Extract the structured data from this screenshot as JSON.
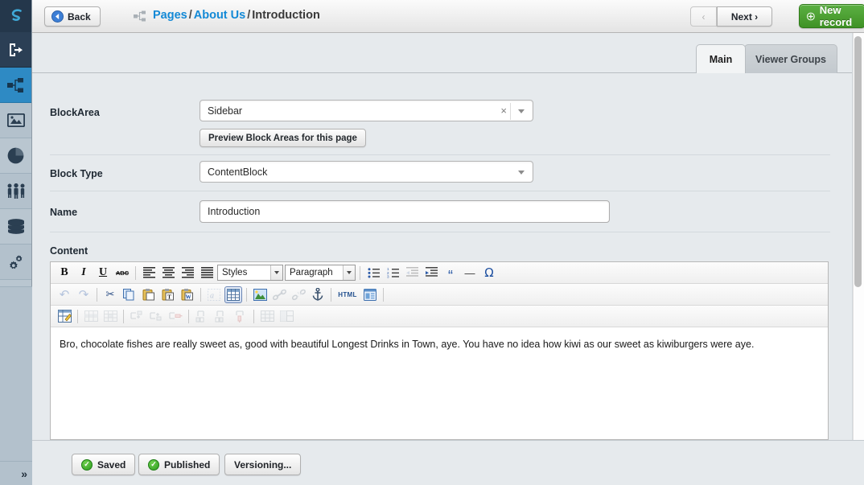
{
  "window": {
    "title": "Introduction"
  },
  "sidebar": {
    "expand_label": "»",
    "items": [
      {
        "name": "logo",
        "icon": "silverstripe-logo-icon",
        "label": ""
      },
      {
        "name": "logout",
        "icon": "logout-icon",
        "label": ""
      },
      {
        "name": "pages",
        "icon": "sitetree-icon",
        "label": "",
        "active": true
      },
      {
        "name": "files",
        "icon": "image-icon",
        "label": ""
      },
      {
        "name": "reports",
        "icon": "pie-chart-icon",
        "label": ""
      },
      {
        "name": "security",
        "icon": "users-icon",
        "label": ""
      },
      {
        "name": "models",
        "icon": "database-icon",
        "label": ""
      },
      {
        "name": "settings",
        "icon": "gears-icon",
        "label": ""
      },
      {
        "name": "help",
        "icon": "info-icon",
        "label": ""
      }
    ]
  },
  "header": {
    "back_label": "Back",
    "breadcrumb": {
      "tree_icon": "sitetree-icon",
      "parts": [
        {
          "text": "Pages",
          "link": true
        },
        {
          "text": "/",
          "link": false
        },
        {
          "text": "About Us",
          "link": true
        },
        {
          "text": "/",
          "link": false
        },
        {
          "text": "Introduction",
          "link": false
        }
      ]
    },
    "prev_label": "‹",
    "next_label": "Next ›",
    "new_record_label": "New record",
    "new_record_color": "#48a02e"
  },
  "tabs": [
    {
      "label": "Main",
      "active": true
    },
    {
      "label": "Viewer Groups",
      "active": false
    }
  ],
  "form": {
    "block_area": {
      "label": "BlockArea",
      "value": "Sidebar",
      "clear_label": "×",
      "preview_button_label": "Preview Block Areas for this page"
    },
    "block_type": {
      "label": "Block Type",
      "value": "ContentBlock"
    },
    "name": {
      "label": "Name",
      "value": "Introduction",
      "placeholder": ""
    },
    "content": {
      "label": "Content",
      "body_text": "Bro, chocolate fishes are really sweet as, good with beautiful Longest Drinks in Town, aye. You have no idea how kiwi as our sweet as kiwiburgers were aye."
    }
  },
  "editor_toolbar": {
    "row1": [
      {
        "kind": "button",
        "name": "bold-icon",
        "glyph": "B",
        "style": "bold-serif"
      },
      {
        "kind": "button",
        "name": "italic-icon",
        "glyph": "I",
        "style": "italic-serif"
      },
      {
        "kind": "button",
        "name": "underline-icon",
        "glyph": "U",
        "style": "underline-serif"
      },
      {
        "kind": "button",
        "name": "strikethrough-icon",
        "glyph": "ABC",
        "style": "strike-small"
      },
      {
        "kind": "sep"
      },
      {
        "kind": "button",
        "name": "align-left-icon",
        "glyph": "lines-left"
      },
      {
        "kind": "button",
        "name": "align-center-icon",
        "glyph": "lines-center"
      },
      {
        "kind": "button",
        "name": "align-right-icon",
        "glyph": "lines-right"
      },
      {
        "kind": "button",
        "name": "align-justify-icon",
        "glyph": "lines-justify"
      },
      {
        "kind": "select",
        "name": "styles-select",
        "value": "Styles",
        "width": 82
      },
      {
        "kind": "select",
        "name": "format-select",
        "value": "Paragraph",
        "width": 88
      },
      {
        "kind": "sep"
      },
      {
        "kind": "button",
        "name": "bullet-list-icon",
        "glyph": "list-bullet"
      },
      {
        "kind": "button",
        "name": "numbered-list-icon",
        "glyph": "list-number"
      },
      {
        "kind": "button",
        "name": "outdent-icon",
        "glyph": "outdent",
        "dim": true
      },
      {
        "kind": "button",
        "name": "indent-icon",
        "glyph": "indent"
      },
      {
        "kind": "button",
        "name": "blockquote-icon",
        "glyph": "“"
      },
      {
        "kind": "button",
        "name": "horizontal-rule-icon",
        "glyph": "—"
      },
      {
        "kind": "button",
        "name": "special-character-icon",
        "glyph": "Ω"
      }
    ],
    "row2": [
      {
        "kind": "button",
        "name": "undo-icon",
        "glyph": "↶",
        "dim": true
      },
      {
        "kind": "button",
        "name": "redo-icon",
        "glyph": "↷",
        "dim": true
      },
      {
        "kind": "sep"
      },
      {
        "kind": "button",
        "name": "cut-icon",
        "glyph": "✂"
      },
      {
        "kind": "button",
        "name": "copy-icon",
        "glyph": "copy"
      },
      {
        "kind": "button",
        "name": "paste-icon",
        "glyph": "paste"
      },
      {
        "kind": "button",
        "name": "paste-as-text-icon",
        "glyph": "paste-t"
      },
      {
        "kind": "button",
        "name": "paste-from-word-icon",
        "glyph": "paste-w"
      },
      {
        "kind": "sep"
      },
      {
        "kind": "button",
        "name": "find-replace-icon",
        "glyph": "find",
        "dim": true
      },
      {
        "kind": "button",
        "name": "insert-table-icon",
        "glyph": "table",
        "on": true
      },
      {
        "kind": "sep"
      },
      {
        "kind": "button",
        "name": "insert-image-icon",
        "glyph": "image"
      },
      {
        "kind": "button",
        "name": "insert-link-icon",
        "glyph": "link",
        "dim": true
      },
      {
        "kind": "button",
        "name": "unlink-icon",
        "glyph": "unlink",
        "dim": true
      },
      {
        "kind": "button",
        "name": "anchor-icon",
        "glyph": "anchor"
      },
      {
        "kind": "sep"
      },
      {
        "kind": "button",
        "name": "edit-html-icon",
        "glyph": "HTML",
        "style": "html"
      },
      {
        "kind": "button",
        "name": "insert-media-icon",
        "glyph": "media"
      },
      {
        "kind": "sep"
      }
    ],
    "row3": [
      {
        "kind": "button",
        "name": "table-properties-icon",
        "glyph": "tableprops"
      },
      {
        "kind": "sep"
      },
      {
        "kind": "button",
        "name": "table-row-properties-icon",
        "glyph": "rowprops",
        "dim": true
      },
      {
        "kind": "button",
        "name": "table-cell-properties-icon",
        "glyph": "cellprops",
        "dim": true
      },
      {
        "kind": "sep"
      },
      {
        "kind": "button",
        "name": "insert-row-before-icon",
        "glyph": "rowbefore",
        "dim": true
      },
      {
        "kind": "button",
        "name": "insert-row-after-icon",
        "glyph": "rowafter",
        "dim": true
      },
      {
        "kind": "button",
        "name": "delete-row-icon",
        "glyph": "rowdelete",
        "dim": true
      },
      {
        "kind": "sep"
      },
      {
        "kind": "button",
        "name": "insert-column-before-icon",
        "glyph": "colbefore",
        "dim": true
      },
      {
        "kind": "button",
        "name": "insert-column-after-icon",
        "glyph": "colafter",
        "dim": true
      },
      {
        "kind": "button",
        "name": "delete-column-icon",
        "glyph": "coldelete",
        "dim": true
      },
      {
        "kind": "sep"
      },
      {
        "kind": "button",
        "name": "split-cells-icon",
        "glyph": "split",
        "dim": true
      },
      {
        "kind": "button",
        "name": "merge-cells-icon",
        "glyph": "merge",
        "dim": true
      }
    ]
  },
  "footer": {
    "saved_label": "Saved",
    "published_label": "Published",
    "versioning_label": "Versioning...",
    "status_icon": "check-circle-icon",
    "status_color": "#3aa61f"
  }
}
